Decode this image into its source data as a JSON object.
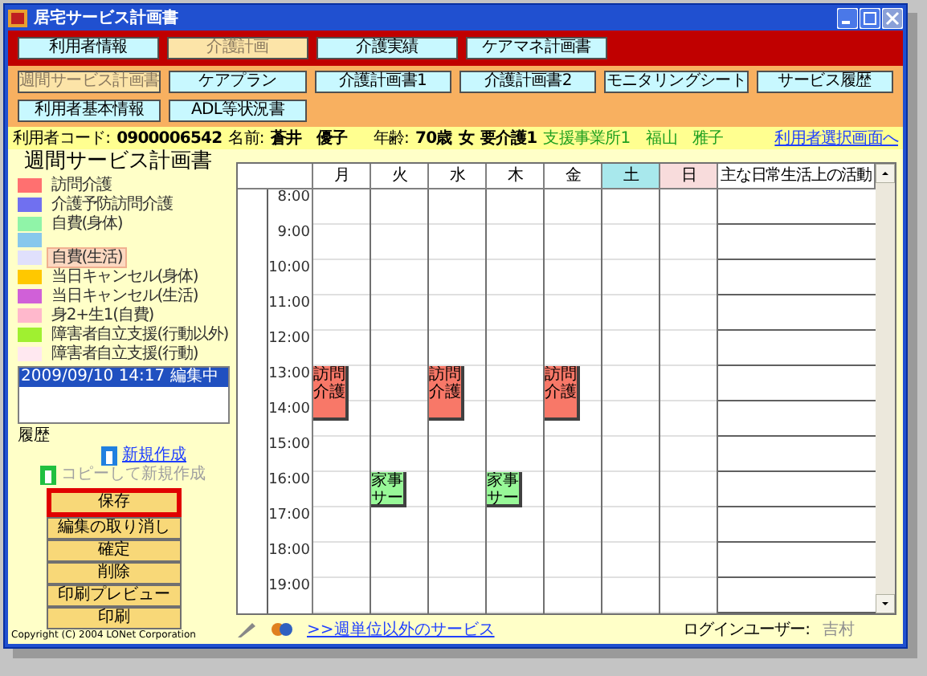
{
  "window": {
    "title": "居宅サービス計画書"
  },
  "main_tabs": [
    {
      "label": "利用者情報",
      "selected": false
    },
    {
      "label": "介護計画",
      "selected": true
    },
    {
      "label": "介護実績",
      "selected": false
    },
    {
      "label": "ケアマネ計画書",
      "selected": false
    }
  ],
  "sub_tabs": [
    {
      "label": "週間サービス計画書",
      "selected": true
    },
    {
      "label": "ケアプラン",
      "selected": false
    },
    {
      "label": "介護計画書1",
      "selected": false
    },
    {
      "label": "介護計画書2",
      "selected": false
    },
    {
      "label": "モニタリングシート",
      "selected": false
    },
    {
      "label": "サービス履歴",
      "selected": false
    },
    {
      "label": "利用者基本情報",
      "selected": false
    },
    {
      "label": "ADL等状況書",
      "selected": false
    }
  ],
  "info_bar": {
    "code_label": "利用者コード:",
    "code": "0900006542",
    "name_label": "名前:",
    "name": "蒼井　優子",
    "age_label": "年齢:",
    "age": "70歳",
    "sex": "女",
    "care_level": "要介護1",
    "office": "支援事業所1",
    "manager": "福山　雅子",
    "select_link": "利用者選択画面へ"
  },
  "sidebar": {
    "title": "週間サービス計画書",
    "legend": [
      {
        "label": "訪問介護",
        "color": "#ff7070",
        "selected": false
      },
      {
        "label": "介護予防訪問介護",
        "color": "#7070f0",
        "selected": false
      },
      {
        "label": "自費(身体)",
        "color": "#90f4a8",
        "selected": false
      },
      {
        "color": "#88c8ec",
        "selected": false
      },
      {
        "label": "自費(生活)",
        "color": "#e0e0fc",
        "selected": true
      },
      {
        "label": "当日キャンセル(身体)",
        "color": "#ffc800",
        "selected": false
      },
      {
        "label": "当日キャンセル(生活)",
        "color": "#d060d8",
        "selected": false
      },
      {
        "label": "身2+生1(自費)",
        "color": "#ffb8cc",
        "selected": false
      },
      {
        "label": "障害者自立支援(行動以外)",
        "color": "#a0f030",
        "selected": false
      },
      {
        "label": "障害者自立支援(行動)",
        "color": "#ffe8f0",
        "selected": false
      }
    ],
    "history_entries": [
      {
        "text": "2009/09/10 14:17 編集中",
        "selected": true
      }
    ],
    "history_label": "履歴",
    "new_link": {
      "text": "新規作成",
      "disabled": false
    },
    "copy_link": {
      "text": "コピーして新規作成",
      "disabled": true
    },
    "buttons": [
      {
        "label": "保存",
        "highlighted": true
      },
      {
        "label": "編集の取り消し",
        "highlighted": false
      },
      {
        "label": "確定",
        "highlighted": false
      },
      {
        "label": "削除",
        "highlighted": false
      },
      {
        "label": "印刷プレビュー",
        "highlighted": false
      },
      {
        "label": "印刷",
        "highlighted": false
      }
    ],
    "copyright": "Copyright (C) 2004 LONet Corporation"
  },
  "schedule": {
    "days": [
      {
        "label": "月"
      },
      {
        "label": "火"
      },
      {
        "label": "水"
      },
      {
        "label": "木"
      },
      {
        "label": "金"
      },
      {
        "label": "土",
        "color": "#a8e8ec"
      },
      {
        "label": "日",
        "color": "#f8dcdc"
      }
    ],
    "activity_header": "主な日常生活上の活動",
    "rows": [
      {
        "time": "8:00"
      },
      {
        "time": "9:00"
      },
      {
        "time": "10:00"
      },
      {
        "time": "11:00"
      },
      {
        "time": "12:00"
      },
      {
        "time": "13:00",
        "cells": [
          {
            "label": "訪問介護",
            "kind": "long",
            "color": "#f87868"
          },
          null,
          {
            "label": "訪問介護",
            "kind": "long",
            "color": "#f87868"
          },
          null,
          {
            "label": "訪問介護",
            "kind": "long",
            "color": "#f87868"
          },
          null,
          null
        ]
      },
      {
        "time": "14:00"
      },
      {
        "time": "15:00"
      },
      {
        "time": "16:00",
        "cells": [
          null,
          {
            "label": "家事サー",
            "kind": "short",
            "color": "#98f898"
          },
          null,
          {
            "label": "家事サー",
            "kind": "short",
            "color": "#98f898"
          },
          null,
          null,
          null
        ]
      },
      {
        "time": "17:00"
      },
      {
        "time": "18:00"
      },
      {
        "time": "19:00"
      }
    ]
  },
  "bottom_bar": {
    "other_services_link": ">>週単位以外のサービス",
    "login_label": "ログインユーザー:",
    "login_user": "吉村"
  }
}
